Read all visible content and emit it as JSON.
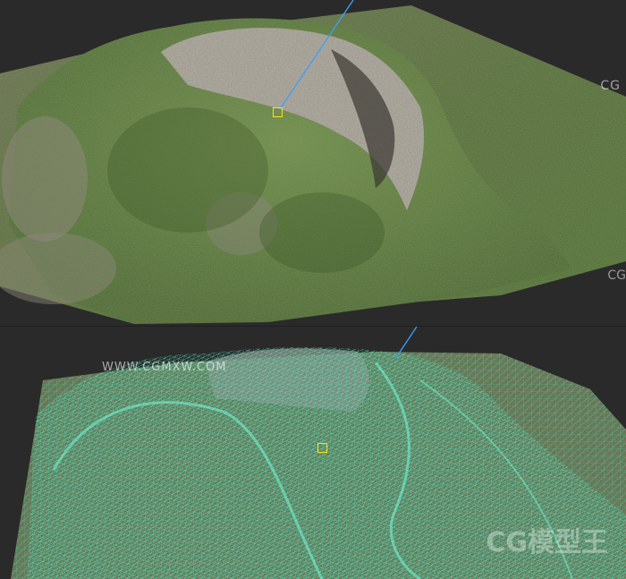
{
  "watermarks": {
    "top_right": "CG",
    "right_side": "CG",
    "mid_url": "WWW.CGMXW.COM",
    "bottom_logo": "CG模型王"
  },
  "colors": {
    "background": "#2b2b2b",
    "wireframe": "#42e6c0",
    "gizmo": "#ffe21a",
    "light_line": "#3aa0ff"
  },
  "icons": {
    "selection": "box-gizmo-icon"
  }
}
